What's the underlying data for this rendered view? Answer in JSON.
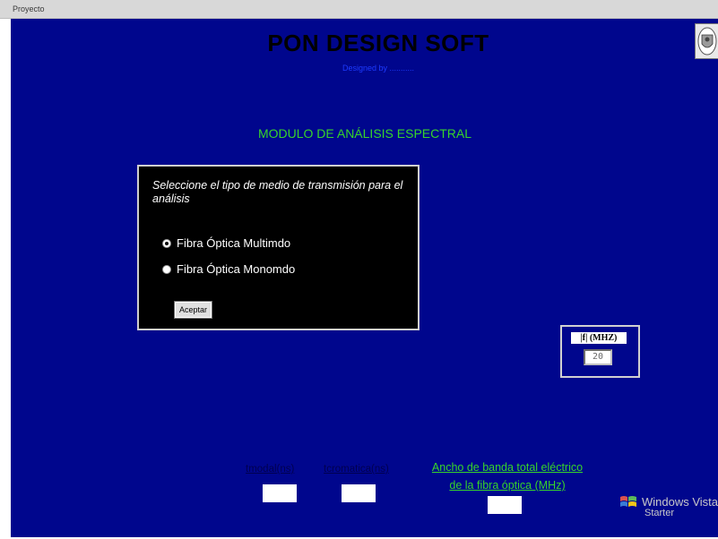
{
  "window": {
    "title": "Proyecto"
  },
  "header": {
    "title": "PON DESIGN SOFT",
    "subtitle": "Designed by ...........",
    "logo_icon": "crest-logo-icon"
  },
  "module": {
    "title": "MODULO DE ANÁLISIS ESPECTRAL"
  },
  "dialog": {
    "prompt": "Seleccione el tipo de medio de transmisión para el análisis",
    "options": [
      {
        "label": "Fibra Óptica Multimdo",
        "checked": true
      },
      {
        "label": "Fibra Óptica Monomdo",
        "checked": false
      }
    ],
    "accept_label": "Aceptar"
  },
  "frequency": {
    "label": "|f| (MHZ)",
    "value": "20"
  },
  "outputs": {
    "modal_label": "tmodal(ns)",
    "modal_value": "",
    "chromatic_label": "tcromatica(ns)",
    "chromatic_value": "",
    "bandwidth_label_line1": "Ancho de banda total eléctrico",
    "bandwidth_label_line2": "de la fibra óptica (MHz)",
    "bandwidth_value": ""
  },
  "watermark": {
    "brand": "Windows Vista",
    "edition": "Starter"
  },
  "colors": {
    "background": "#00068d",
    "accent_green": "#37d42a",
    "dialog_bg": "#000000"
  }
}
